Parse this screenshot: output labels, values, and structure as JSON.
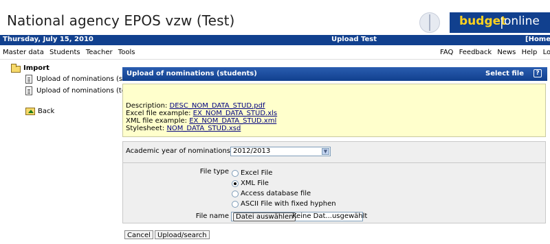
{
  "header": {
    "title": "National agency EPOS vzw (Test)",
    "logo_word1": "budget",
    "logo_sep": "|",
    "logo_word2": "online"
  },
  "status_bar": {
    "date": "Thursday, July 15, 2010",
    "center": "Upload Test",
    "home": "[Home"
  },
  "menu": {
    "left": [
      "Master data",
      "Students",
      "Teacher",
      "Tools"
    ],
    "right": [
      "FAQ",
      "Feedback",
      "News",
      "Help",
      "Logou"
    ]
  },
  "sidebar": {
    "section": "Import",
    "items": [
      "Upload of nominations (stuc",
      "Upload of nominations (teac"
    ],
    "back": "Back"
  },
  "panel": {
    "title": "Upload of nominations (students)",
    "right": "Select file",
    "help_glyph": "?"
  },
  "info": {
    "description_label": "Description: ",
    "description_link": "DESC_NOM_DATA_STUD.pdf",
    "excel_label": "Excel file example: ",
    "excel_link": "EX_NOM_DATA_STUD.xls",
    "xml_label": "XML file example: ",
    "xml_link": "EX_NOM_DATA_STUD.xml",
    "stylesheet_label": "Stylesheet: ",
    "stylesheet_link": "NOM_DATA_STUD.xsd"
  },
  "form": {
    "year_label": "Academic year of nominations",
    "year_value": "2012/2013",
    "filetype_label": "File type",
    "filetype_options": [
      "Excel File",
      "XML File",
      "Access database file",
      "ASCII File with fixed hyphen"
    ],
    "filetype_selected": "XML File",
    "filename_label": "File name",
    "file_button": "Datei auswählen",
    "file_status": "Keine Dat...usgewählt"
  },
  "actions": {
    "cancel": "Cancel",
    "upload": "Upload/search"
  },
  "colors": {
    "brand_blue": "#11408e",
    "logo_yellow": "#ffd21f",
    "info_bg": "#ffffcc",
    "form_bg": "#efefef"
  }
}
